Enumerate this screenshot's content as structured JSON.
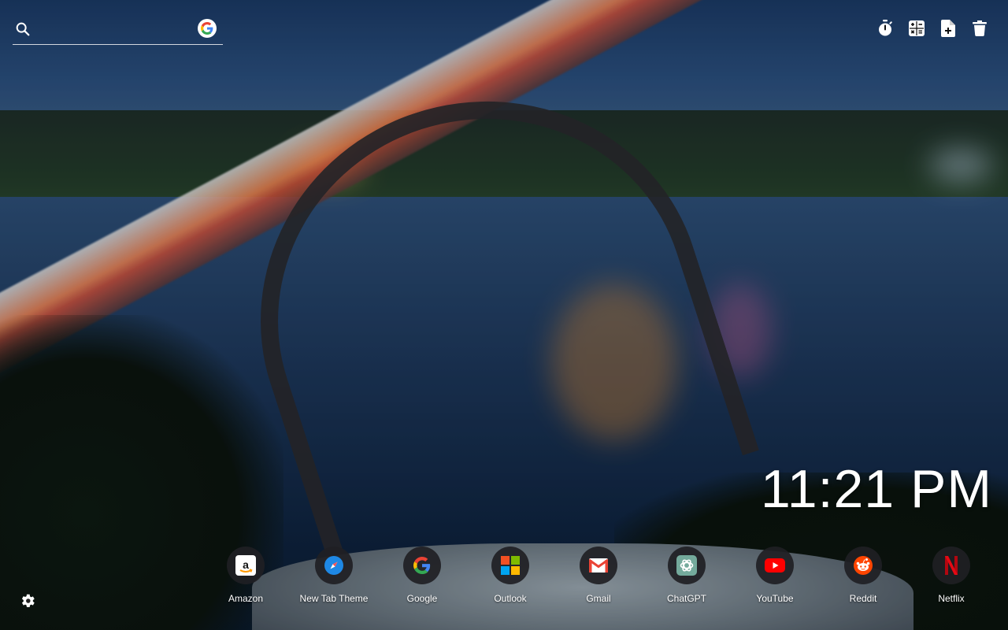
{
  "search": {
    "placeholder": "",
    "value": ""
  },
  "toolbar": {
    "items": [
      {
        "name": "timer-icon"
      },
      {
        "name": "calculator-icon"
      },
      {
        "name": "new-note-icon"
      },
      {
        "name": "trash-icon"
      }
    ]
  },
  "clock": {
    "time": "11:21 PM"
  },
  "shortcuts": [
    {
      "label": "Amazon",
      "icon": "amazon-icon"
    },
    {
      "label": "New Tab Theme",
      "icon": "compass-icon"
    },
    {
      "label": "Google",
      "icon": "google-icon"
    },
    {
      "label": "Outlook",
      "icon": "microsoft-icon"
    },
    {
      "label": "Gmail",
      "icon": "gmail-icon"
    },
    {
      "label": "ChatGPT",
      "icon": "chatgpt-icon"
    },
    {
      "label": "YouTube",
      "icon": "youtube-icon"
    },
    {
      "label": "Reddit",
      "icon": "reddit-icon"
    },
    {
      "label": "Netflix",
      "icon": "netflix-icon"
    }
  ],
  "colors": {
    "google_blue": "#4285F4",
    "google_red": "#EA4335",
    "google_yellow": "#FBBC05",
    "google_green": "#34A853",
    "youtube_red": "#FF0000",
    "reddit_orange": "#FF4500",
    "netflix_red": "#E50914"
  }
}
